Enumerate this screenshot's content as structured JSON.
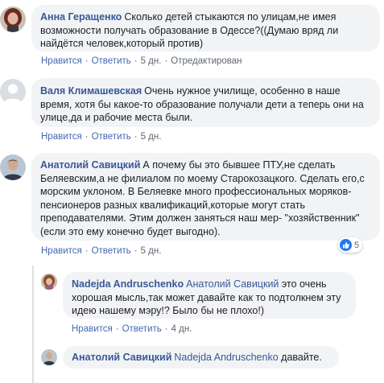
{
  "comments": [
    {
      "author": "Анна Геращенко",
      "text": "Сколько детей стыкаются по улицам,не имея возможности получать образование в Одессе?((Думаю вряд ли найдётся человек,который против)",
      "actions": {
        "like": "Нравится",
        "reply": "Ответить",
        "time": "5 дн.",
        "edited": "Отредактирован"
      }
    },
    {
      "author": "Валя Климашевская",
      "text": "Очень нужное училище, особенно в наше время, хотя бы какое-то образование получали дети а теперь они на улице,да и рабочие места были.",
      "actions": {
        "like": "Нравится",
        "reply": "Ответить",
        "time": "5 дн."
      }
    },
    {
      "author": "Анатолий Савицкий",
      "text": "А почему бы это бывшее ПТУ,не сделать Беляевским,а не филиалом по моему Старокозацкого. Сделать его,с морским уклоном. В Беляевке много профессиональных моряков-пенсионеров разных квалификаций,которые могут стать преподавателями. Этим должен заняться наш мер- \"хозяйственник\"(если это ему конечно будет выгодно).",
      "reaction_count": "5",
      "actions": {
        "like": "Нравится",
        "reply": "Ответить",
        "time": "5 дн."
      }
    }
  ],
  "replies": [
    {
      "author": "Nadejda Andruschenko",
      "mention": "Анатолий Савицкий",
      "text": "это очень хорошая мысль,так может давайте как то подтолкнем эту идею нашему мэру!? Было бы не плохо!)",
      "actions": {
        "like": "Нравится",
        "reply": "Ответить",
        "time": "4 дн."
      }
    },
    {
      "author": "Анатолий Савицкий",
      "mention": "Nadejda Andruschenko",
      "text": "давайте."
    }
  ],
  "colors": {
    "link": "#385898",
    "bubble": "#f2f3f5",
    "meta": "#606770",
    "like_blue": "#2078f4"
  }
}
